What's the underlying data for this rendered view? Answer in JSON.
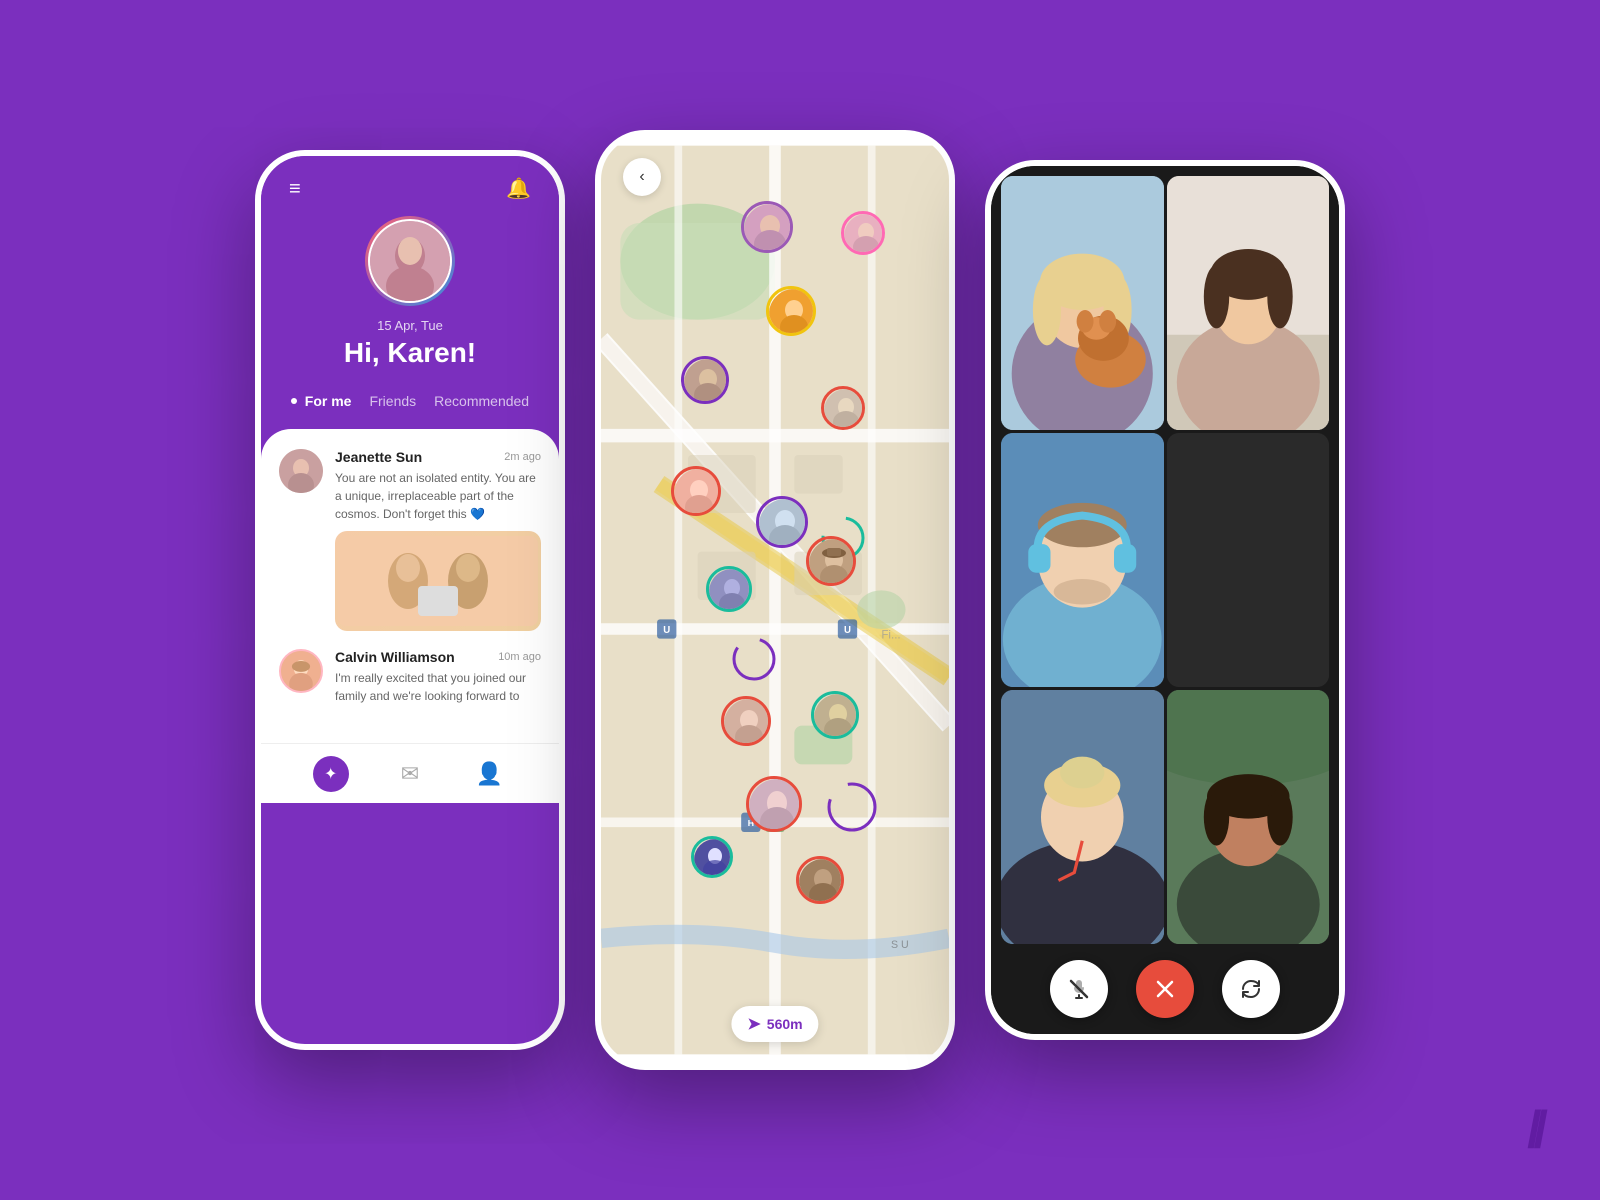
{
  "bg_color": "#7B2FBE",
  "phone1": {
    "date": "15 Apr, Tue",
    "greeting": "Hi, Karen!",
    "tabs": [
      "For me",
      "Friends",
      "Recommended"
    ],
    "active_tab": "For me",
    "messages": [
      {
        "name": "Jeanette Sun",
        "time": "2m ago",
        "text": "You are not an isolated entity. You are a unique, irreplaceable part of the cosmos. Don't forget this 💙",
        "has_image": true
      },
      {
        "name": "Calvin Williamson",
        "time": "10m ago",
        "text": "I'm really excited that you joined our family and we're looking forward to",
        "has_image": false
      }
    ]
  },
  "phone2": {
    "back_icon": "‹",
    "distance_icon": "➤",
    "distance": "560m"
  },
  "phone3": {
    "controls": {
      "mute_icon": "🎤",
      "end_icon": "✕",
      "flip_icon": "↻"
    }
  },
  "logo": "//"
}
